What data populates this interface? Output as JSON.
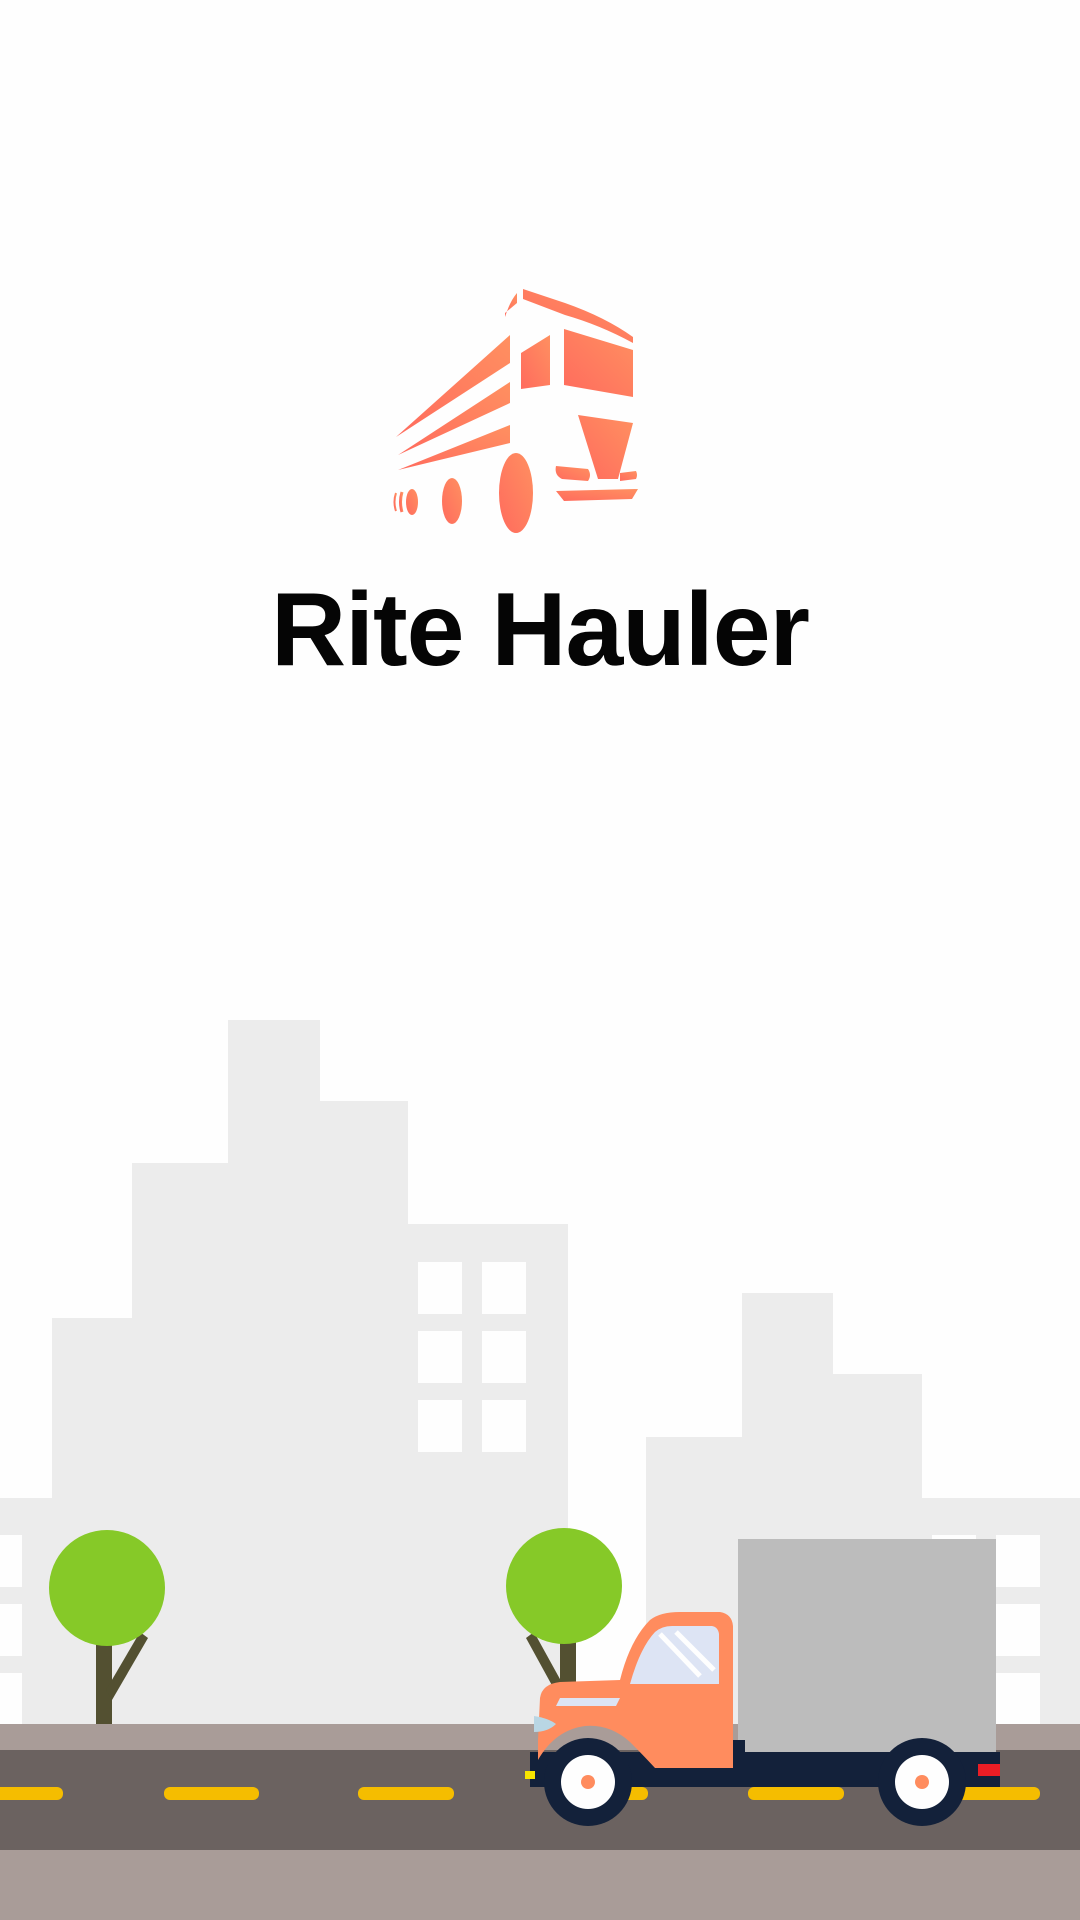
{
  "app": {
    "title": "Rite Hauler",
    "logo_icon": "truck-logo-icon"
  },
  "colors": {
    "background": "#fefefe",
    "brand_gradient_start": "#ff6b5e",
    "brand_gradient_end": "#ff9060",
    "buildings": "#ececec",
    "building_windows": "#fefefe",
    "tree_foliage": "#86c928",
    "tree_trunk": "#535031",
    "sidewalk": "#a99c98",
    "road": "#6b6260",
    "lane_marking": "#f5bd00",
    "truck_cab": "#ff8c5e",
    "truck_cargo": "#bcbcbc",
    "truck_chassis": "#13213a"
  },
  "scene": {
    "icons": [
      "city-skyline",
      "tree",
      "delivery-truck",
      "road"
    ]
  }
}
